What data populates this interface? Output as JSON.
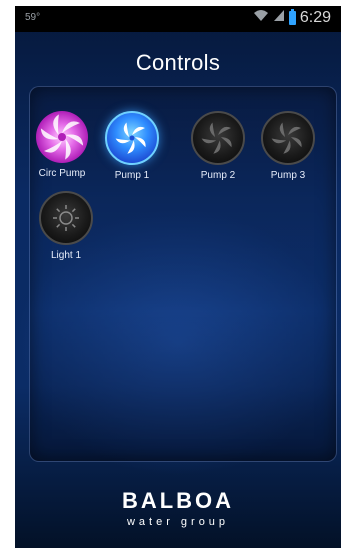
{
  "status_bar": {
    "left_text": "59°",
    "time": "6:29",
    "wifi_icon": "wifi-icon",
    "signal_icon": "signal-icon",
    "battery_icon": "battery-icon"
  },
  "header": {
    "title": "Controls"
  },
  "controls": [
    {
      "label": "Circ Pump",
      "icon": "pump-icon",
      "state": "on",
      "color": "#e46ae8"
    },
    {
      "label": "Pump 1",
      "icon": "pump-icon",
      "state": "on",
      "color": "#2f8dff"
    },
    {
      "label": "Pump 2",
      "icon": "pump-icon",
      "state": "off",
      "color": "#1a1a1a"
    },
    {
      "label": "Pump 3",
      "icon": "pump-icon",
      "state": "off",
      "color": "#1a1a1a"
    },
    {
      "label": "Light 1",
      "icon": "light-icon",
      "state": "off",
      "color": "#1a1a1a"
    }
  ],
  "footer": {
    "brand": "BALBOA",
    "tagline": "water group"
  },
  "colors": {
    "background_top": "#06183a",
    "background_mid": "#0b2c66",
    "accent_blue": "#2fa3ff",
    "text_white": "#ffffff"
  }
}
